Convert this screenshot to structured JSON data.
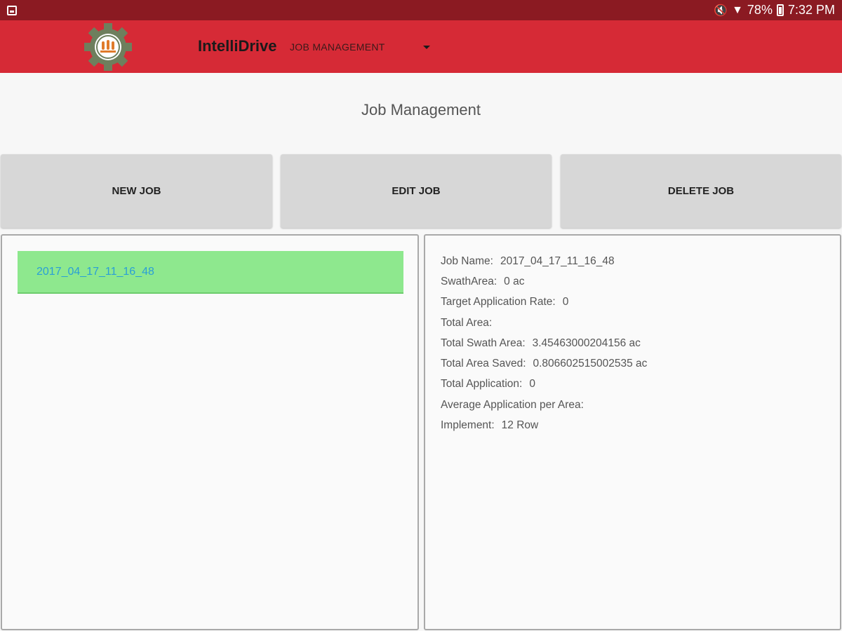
{
  "status_bar": {
    "battery": "78%",
    "time": "7:32 PM"
  },
  "app_bar": {
    "title": "IntelliDrive",
    "nav_selected": "JOB MANAGEMENT"
  },
  "page": {
    "title": "Job Management"
  },
  "buttons": {
    "new_job": "NEW JOB",
    "edit_job": "EDIT JOB",
    "delete_job": "DELETE JOB"
  },
  "job_list": [
    {
      "name": "2017_04_17_11_16_48"
    }
  ],
  "details": [
    {
      "label": "Job Name:",
      "value": "2017_04_17_11_16_48"
    },
    {
      "label": "SwathArea:",
      "value": "0 ac"
    },
    {
      "label": "Target Application Rate:",
      "value": "0"
    },
    {
      "label": "Total Area:",
      "value": ""
    },
    {
      "label": "Total Swath Area:",
      "value": "3.45463000204156 ac"
    },
    {
      "label": "Total Area Saved:",
      "value": "0.806602515002535 ac"
    },
    {
      "label": "Total Application:",
      "value": "0"
    },
    {
      "label": "Average Application per Area:",
      "value": ""
    },
    {
      "label": "Implement:",
      "value": "12 Row"
    }
  ],
  "colors": {
    "status_bar": "#8b1a22",
    "app_bar": "#d62a36",
    "selected_job_bg": "#8ee88e",
    "selected_job_text": "#2a9fd6"
  }
}
